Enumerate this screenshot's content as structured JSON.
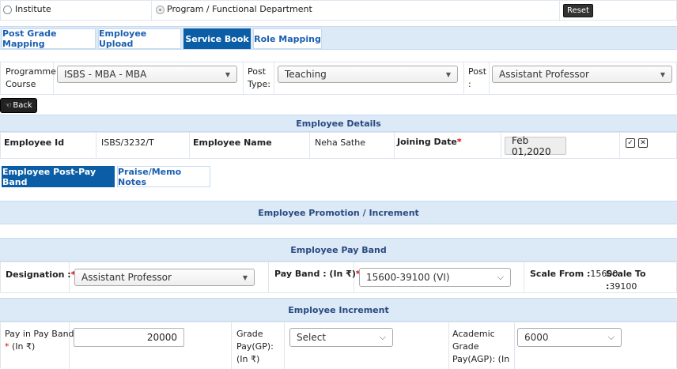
{
  "filter": {
    "radio_institute": "Institute",
    "radio_program": "Program / Functional Department",
    "reset_label": "Reset"
  },
  "tabs": [
    "Post Grade Mapping",
    "Employee Upload",
    "Service Book",
    "Role Mapping"
  ],
  "selectors": {
    "programme_label_1": "Programme /",
    "programme_label_2": "Course",
    "programme_value": "ISBS - MBA - MBA",
    "post_type_label_1": "Post",
    "post_type_label_2": "Type:",
    "post_type_value": "Teaching",
    "post_label_1": "Post",
    "post_label_2": ":",
    "post_value": "Assistant Professor"
  },
  "back_label": "Back",
  "employee_details": {
    "title": "Employee Details",
    "id_label": "Employee Id",
    "id_value": "ISBS/3232/T",
    "name_label": "Employee Name",
    "name_value": "Neha Sathe",
    "joining_label": "Joining Date",
    "joining_required": "*",
    "joining_value": "Feb 01,2020"
  },
  "sub_tabs": [
    "Employee Post-Pay Band",
    "Praise/Memo Notes"
  ],
  "promotion_title": "Employee Promotion / Increment",
  "pay_band": {
    "title": "Employee Pay Band",
    "designation_label": "Designation :",
    "designation_required": "*",
    "designation_value": "Assistant Professor",
    "payband_label": "Pay Band : (In ₹)",
    "payband_required": "*",
    "payband_value": "15600-39100 (VI)",
    "scale_from_label": "Scale From :",
    "scale_from_value": "15600",
    "scale_to_label": "Scale To :",
    "scale_to_value": "39100"
  },
  "increment": {
    "title": "Employee Increment",
    "pay_label_1": "Pay in Pay Band:",
    "pay_required": "*",
    "pay_label_2": " (In ₹)",
    "pay_value": "20000",
    "gp_label_1": "Grade",
    "gp_label_2": "Pay(GP):",
    "gp_label_3": "(In ₹)",
    "gp_value": "Select",
    "agp_label_1": "Academic",
    "agp_label_2": "Grade",
    "agp_label_3": "Pay(AGP): (In",
    "agp_value": "6000"
  }
}
